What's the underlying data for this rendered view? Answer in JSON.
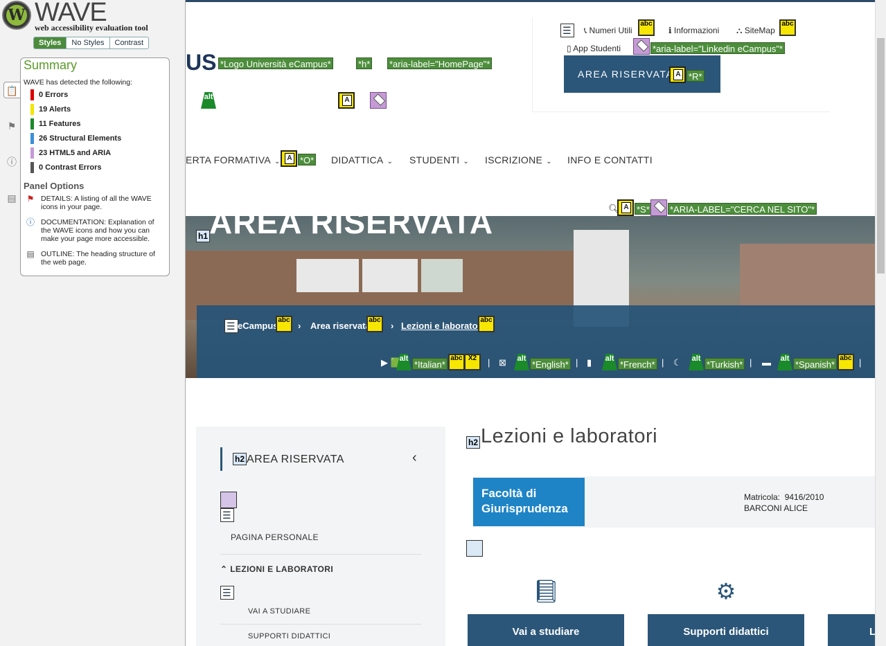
{
  "wave": {
    "title": "WAVE",
    "subtitle": "web accessibility evaluation tool",
    "tabs": [
      "Styles",
      "No Styles",
      "Contrast"
    ],
    "summary_title": "Summary",
    "detected": "WAVE has detected the following:",
    "counts": [
      {
        "label": "0 Errors",
        "color": "#dd0000"
      },
      {
        "label": "19 Alerts",
        "color": "#f2e600"
      },
      {
        "label": "11 Features",
        "color": "#1a8a2a"
      },
      {
        "label": "26 Structural Elements",
        "color": "#3b8fd9"
      },
      {
        "label": "23 HTML5 and ARIA",
        "color": "#c59bd6"
      },
      {
        "label": "0 Contrast Errors",
        "color": "#555555"
      }
    ],
    "panel_options": "Panel Options",
    "options": [
      {
        "icon": "flag-icon",
        "text": "DETAILS: A listing of all the WAVE icons in your page."
      },
      {
        "icon": "info-icon",
        "text": "DOCUMENTATION: Explanation of the WAVE icons and how you can make your page more accessible."
      },
      {
        "icon": "document-icon",
        "text": "OUTLINE: The heading structure of the web page."
      }
    ]
  },
  "header": {
    "logo_fragment": "US",
    "labels": {
      "logo": "*Logo Università eCampus*",
      "h": "*h*",
      "homepage": "*aria-label=\"HomePage\"*",
      "linkedin": "*aria-label=\"Linkedin eCampus\"*",
      "r": "*R*",
      "o": "*O*",
      "s": "*S*",
      "cerca": "*ARIA-LABEL=\"CERCA NEL SITO\"*"
    },
    "top_links": [
      "Numeri Utili",
      "Informazioni",
      "SiteMap",
      "App Studenti"
    ],
    "area_button": "AREA RISERVATA",
    "alt_icon_label": "alt",
    "abc_icon_label": "abc"
  },
  "nav": {
    "items": [
      "ERTA FORMATIVA",
      "DIDATTICA",
      "STUDENTI",
      "ISCRIZIONE",
      "INFO E CONTATTI"
    ]
  },
  "hero": {
    "title": "AREA RISERVATA",
    "breadcrumb": [
      "eCampus",
      "Area riservata",
      "Lezioni e laboratori"
    ],
    "languages": [
      "*Italian*",
      "*English*",
      "*French*",
      "*Turkish*",
      "*Spanish*"
    ],
    "x2": "X2"
  },
  "sidebar_menu": {
    "title": "AREA RISERVATA",
    "items": [
      "PAGINA PERSONALE",
      "LEZIONI E LABORATORI",
      "VAI A STUDIARE",
      "SUPPORTI DIDATTICI"
    ]
  },
  "content": {
    "title": "Lezioni e laboratori",
    "faculty": "Facoltà di Giurisprudenza",
    "matricola_label": "Matricola:",
    "matricola_value": "9416/2010",
    "student_name": "BARCONI ALICE",
    "cards": [
      "Vai a studiare",
      "Supporti didattici",
      "L"
    ]
  },
  "headings": {
    "h1": "h1",
    "h2": "h2"
  }
}
